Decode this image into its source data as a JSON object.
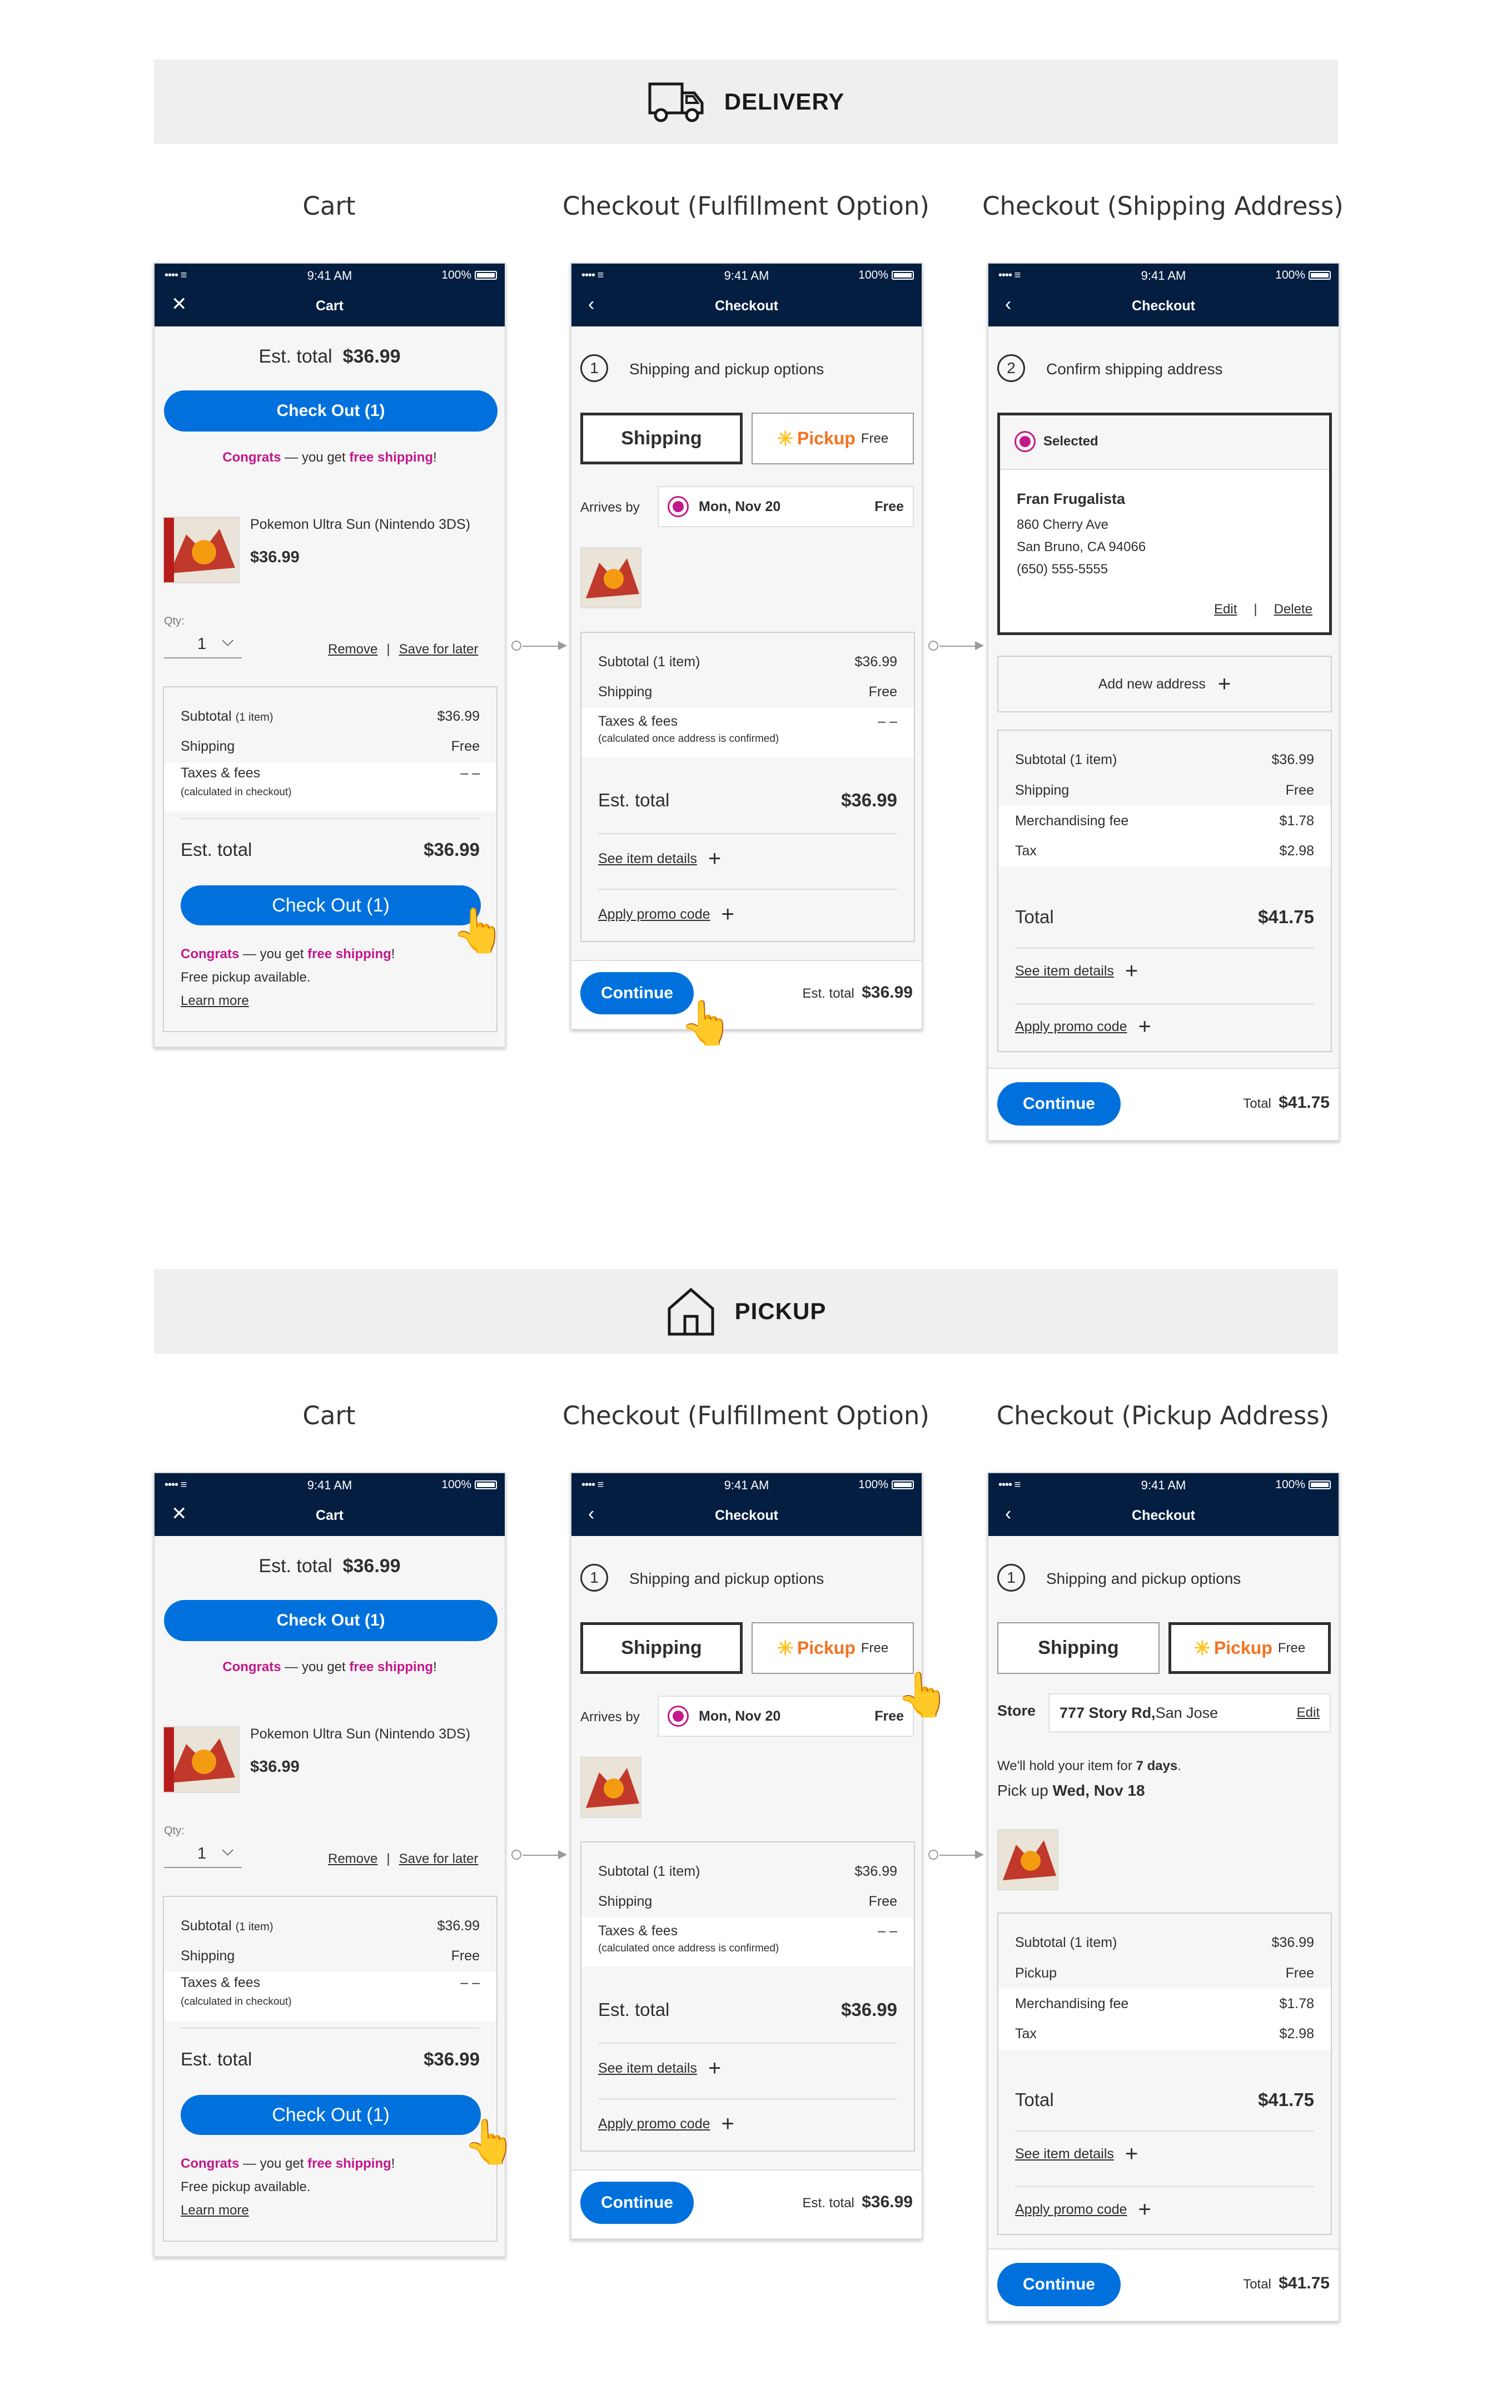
{
  "status": {
    "time": "9:41 AM",
    "battery": "100%",
    "signal": "•••• ≡"
  },
  "delivery": {
    "label": "DELIVERY",
    "col1": "Cart",
    "col2": "Checkout (Fulfillment Option)",
    "col3": "Checkout (Shipping Address)"
  },
  "pickup": {
    "label": "PICKUP",
    "col1": "Cart",
    "col2": "Checkout (Fulfillment Option)",
    "col3": "Checkout (Pickup Address)"
  },
  "cart": {
    "title": "Cart",
    "est_total_label": "Est. total",
    "est_total": "$36.99",
    "checkout_btn": "Check Out (1)",
    "congrats": "Congrats",
    "congrats_mid": " — you get ",
    "free_shipping": "free shipping",
    "excl": "!",
    "product": "Pokemon Ultra Sun (Nintendo 3DS)",
    "price": "$36.99",
    "qty_label": "Qty:",
    "qty": "1",
    "remove": "Remove",
    "sep": "|",
    "save_later": "Save for later",
    "subtotal_label": "Subtotal",
    "subtotal_items": "(1 item)",
    "subtotal": "$36.99",
    "shipping_label": "Shipping",
    "shipping": "Free",
    "taxes_label": "Taxes & fees",
    "taxes_note": "(calculated in checkout)",
    "taxes": "– –",
    "est_label": "Est. total",
    "est": "$36.99",
    "free_pickup": "Free pickup available.",
    "learn_more": "Learn more"
  },
  "fulfill": {
    "title": "Checkout",
    "step": "1",
    "step_label": "Shipping and pickup options",
    "tab_shipping": "Shipping",
    "tab_pickup": "Pickup",
    "tab_pickup_free": "Free",
    "arrives_label": "Arrives by",
    "arrives_date": "Mon, Nov 20",
    "arrives_free": "Free",
    "subtotal_label": "Subtotal (1 item)",
    "subtotal": "$36.99",
    "shipping_label": "Shipping",
    "shipping": "Free",
    "taxes_label": "Taxes & fees",
    "taxes_note": "(calculated once address is confirmed)",
    "taxes": "– –",
    "est_label": "Est. total",
    "est": "$36.99",
    "see_details": "See item details",
    "promo": "Apply promo code",
    "continue": "Continue",
    "foot_est_label": "Est. total",
    "foot_est": "$36.99"
  },
  "shipaddr": {
    "title": "Checkout",
    "step": "2",
    "step_label": "Confirm shipping address",
    "selected": "Selected",
    "name": "Fran Frugalista",
    "street": "860 Cherry Ave",
    "city": "San Bruno, CA 94066",
    "phone": "(650) 555-5555",
    "edit": "Edit",
    "sep": "|",
    "delete": "Delete",
    "add_new": "Add new address",
    "subtotal_label": "Subtotal (1 item)",
    "subtotal": "$36.99",
    "shipping_label": "Shipping",
    "shipping": "Free",
    "merch_label": "Merchandising fee",
    "merch": "$1.78",
    "tax_label": "Tax",
    "tax": "$2.98",
    "total_label": "Total",
    "total": "$41.75",
    "see_details": "See item details",
    "promo": "Apply promo code",
    "continue": "Continue",
    "foot_total_label": "Total",
    "foot_total": "$41.75"
  },
  "pickaddr": {
    "title": "Checkout",
    "step": "1",
    "step_label": "Shipping and pickup options",
    "tab_shipping": "Shipping",
    "tab_pickup": "Pickup",
    "tab_pickup_free": "Free",
    "store_label": "Store",
    "store_num": "777 Story Rd,",
    "store_city": " San Jose",
    "edit": "Edit",
    "hold_pre": "We'll hold your item for ",
    "hold_days": "7 days",
    "hold_post": ".",
    "pickup_pre": "Pick up ",
    "pickup_date": "Wed, Nov 18",
    "subtotal_label": "Subtotal (1 item)",
    "subtotal": "$36.99",
    "pickup_label": "Pickup",
    "pickup": "Free",
    "merch_label": "Merchandising fee",
    "merch": "$1.78",
    "tax_label": "Tax",
    "tax": "$2.98",
    "total_label": "Total",
    "total": "$41.75",
    "see_details": "See item details",
    "promo": "Apply promo code",
    "continue": "Continue",
    "foot_total_label": "Total",
    "foot_total": "$41.75"
  },
  "colors": {
    "navy": "#041e42",
    "blue": "#0071dc",
    "pink": "#c2188b",
    "orange": "#f47321",
    "yellow": "#ffc220"
  },
  "icons": {
    "delivery": "truck-icon",
    "pickup": "house-icon",
    "pointer": "hand-pointer-icon"
  }
}
